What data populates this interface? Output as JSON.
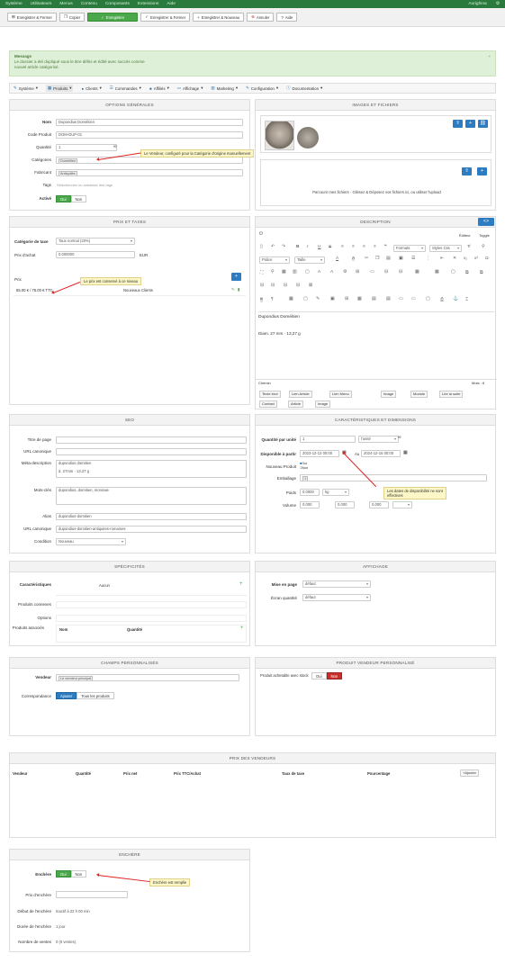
{
  "topbar": {
    "menu": [
      "Système",
      "Utilisateurs",
      "Menus",
      "Contenu",
      "Composants",
      "Extensions",
      "Aide"
    ],
    "right": [
      "Aurighina",
      "⚙"
    ]
  },
  "toolbar": {
    "buttons": [
      "Enregistrer & Fermer",
      "Copier",
      "Enregistrer",
      "Enregistrer & Fermer",
      "Enregistrer & Nouveau",
      "Annuler",
      "Aide"
    ]
  },
  "message": {
    "title": "Message",
    "line1": "Le dossier a été dupliqué sous le titre défini et édité avec succès comme",
    "line2": "nouvel article catégorisé."
  },
  "nav": [
    "Système",
    "Produits",
    "Clients",
    "Commandes",
    "Affiliés",
    "Affichage",
    "Marketing",
    "Configuration",
    "Documentation"
  ],
  "general": {
    "title": "Options générales",
    "labels": {
      "name": "Nom",
      "code": "Code Produit",
      "qty": "Quantité",
      "cat": "Catégories",
      "maker": "Fabricant",
      "tags": "Tags",
      "published": "Activé"
    },
    "values": {
      "name": "Dupondius Doméitien",
      "code": "DOM-DUP-01",
      "qty": "1",
      "cat": "Doméitien",
      "maker": "Antiquités",
      "tags": "Sélectionnez ou saisissez des tags"
    },
    "yes": "Oui",
    "no": "Non",
    "tip": "Le Vendeur, configuré pour la Catégorie d'origine manuellement"
  },
  "images": {
    "title": "Images et Fichiers",
    "caption": "Parcourir mes fichiers · Glissez & Déposez vos fichiers ici, ou utiliser l'upload"
  },
  "price": {
    "title": "Prix et Taxes",
    "tax_label": "Catégorie de taxe",
    "tax_value": "Taux normal (20%)",
    "cost_label": "Prix d'achat",
    "cost_value": "0.000000",
    "currency": "EUR",
    "price_label": "Prix",
    "price_value": "65.00 € / 78.00 € TTC",
    "price_user": "Nouveaux Clients",
    "tip": "Le prix est conservé à ce niveau"
  },
  "desc": {
    "title": "Description",
    "tabs": [
      "Éditeur",
      "Toggle"
    ],
    "text1": "Dupondius Doméitien",
    "text2": "Diam. 27 mm · 13,27 g",
    "status": "Chemin",
    "words": "Mots : 6",
    "buttons": [
      "Texte brut",
      "Lien Article",
      "Lien Menu",
      "Image",
      "Module",
      "Lire la suite",
      "Contact",
      "Article",
      "Image"
    ],
    "fmt": [
      "Formats",
      "Styles Css",
      "Police",
      "Taille"
    ]
  },
  "seo": {
    "title": "SEO",
    "labels": [
      "Titre de page",
      "URL canonique",
      "Méta-description",
      "Mots-clés",
      "Alias",
      "URL canonique",
      "Condition"
    ],
    "meta": "dupondius domitien",
    "meta2": "d. 27mm · 13.27 g",
    "keywords": "dupondius, domitien, monnaie",
    "alias": "dupondius-domitien",
    "canonical": "dupondius-domitien-antiquites-romaines",
    "condition": "Nouveau"
  },
  "dims": {
    "title": "Caractéristiques et dimensions",
    "labels": [
      "Quantité par unité",
      "Disponible à partir",
      "Nouveau Produit",
      "Emballage",
      "Poids",
      "Volume"
    ],
    "qty_unit": "1",
    "qty_type": "l'unité",
    "date_from": "2023-12-12 00:00",
    "date_to": "2024-12-15 00:00",
    "avail": "Au",
    "new_yes": "Oui",
    "new_no": "Non",
    "pack": "1",
    "weight": "0.0000",
    "weight_unit": "kg",
    "vol": "0.000",
    "tip1": "Les dates de disponibilité ne sont",
    "tip2": "effectives"
  },
  "specs": {
    "title": "Spécificités",
    "labels": [
      "Caractéristiques",
      "Produits connexes",
      "Options",
      "Produits associés"
    ],
    "none": "Aucun",
    "cols": [
      "Nom",
      "Quantité"
    ]
  },
  "display": {
    "title": "Affichage",
    "labels": [
      "Mise en page",
      "Écran quantité"
    ],
    "layout": "défaut",
    "qty": "défaut"
  },
  "custom": {
    "title": "Champs personnalisés",
    "labels": [
      "Vendeur",
      "Correspondance"
    ],
    "vendor": "Le vendeur principal",
    "btns": [
      "Ajouter",
      "Tous les produits"
    ]
  },
  "custfields": {
    "title": "Produit vendeur personnalisé",
    "label": "Produit achetable avec stock",
    "yes": "Oui",
    "no": "Non"
  },
  "hist": {
    "title": "Prix des vendeurs",
    "cols": [
      "Vendeur",
      "Quantité",
      "Prix net",
      "Prix TTC/Achat",
      "Taux de taxe",
      "Pourcentage"
    ],
    "btn": "Ajouter"
  },
  "auction": {
    "title": "Enchère",
    "labels": [
      "Enchère",
      "Prix d'enchère",
      "Début de l'enchère",
      "Durée de l'enchère",
      "Nombre de ventes"
    ],
    "yes": "Oui",
    "no": "Non",
    "start": "Inactif à 22 h 00 min",
    "dur": "1 jour",
    "count": "0 (0 ventes)",
    "tip": "Enchère est remplie"
  }
}
